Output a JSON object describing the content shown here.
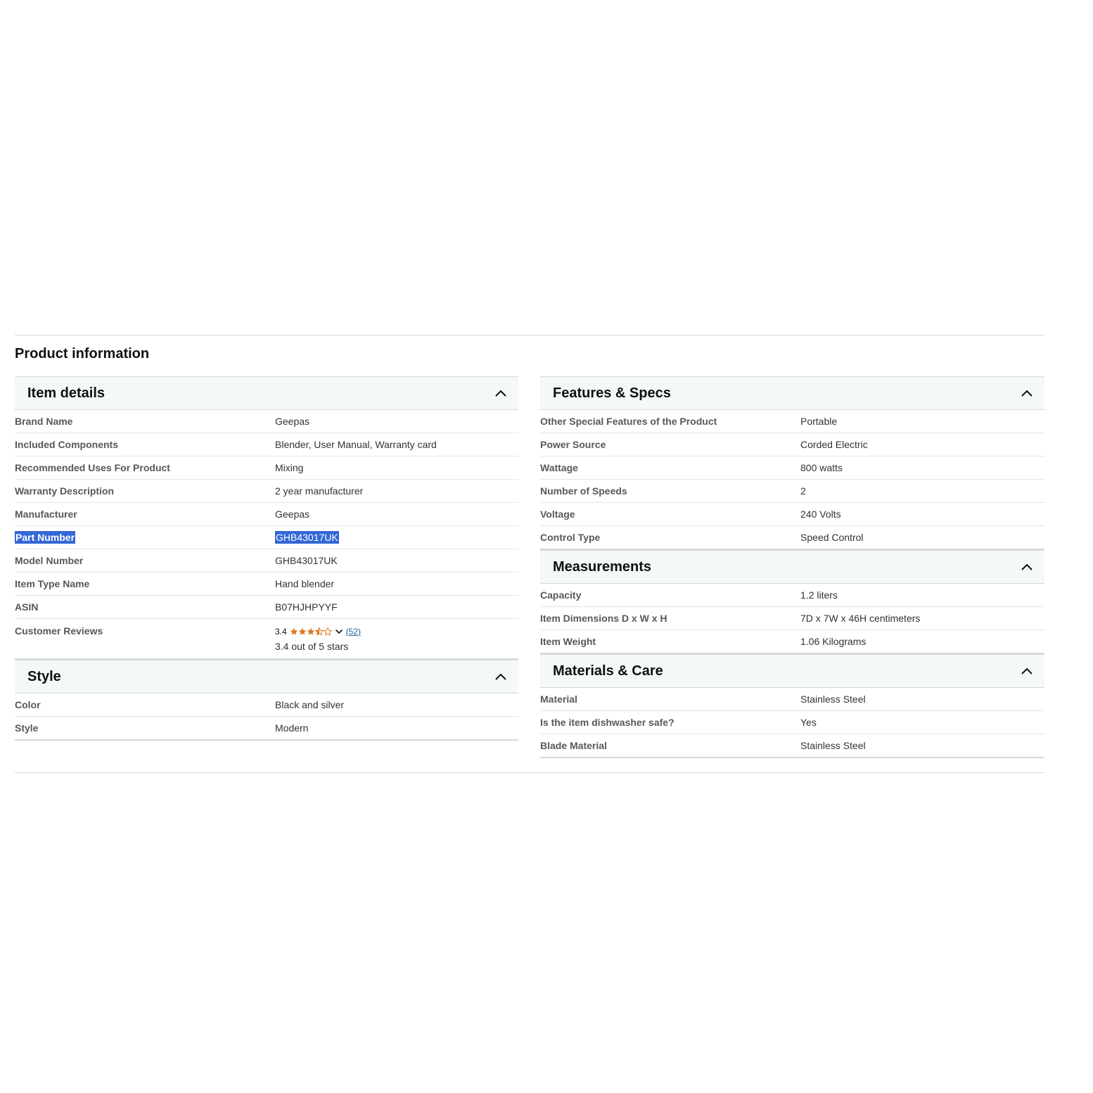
{
  "page_title": "Product information",
  "colors": {
    "accent_star": "#de7921",
    "link": "#2162a1",
    "selection": "#3367d6"
  },
  "item_details": {
    "title": "Item details",
    "rows": [
      {
        "key": "Brand Name",
        "value": "Geepas"
      },
      {
        "key": "Included Components",
        "value": "Blender, User Manual, Warranty card"
      },
      {
        "key": "Recommended Uses For Product",
        "value": "Mixing"
      },
      {
        "key": "Warranty Description",
        "value": "2 year manufacturer"
      },
      {
        "key": "Manufacturer",
        "value": "Geepas"
      },
      {
        "key": "Part Number",
        "value": "GHB43017UK"
      },
      {
        "key": "Model Number",
        "value": "GHB43017UK"
      },
      {
        "key": "Item Type Name",
        "value": "Hand blender"
      },
      {
        "key": "ASIN",
        "value": "B07HJHPYYF"
      }
    ],
    "reviews": {
      "key": "Customer Reviews",
      "rating": "3.4",
      "rating_value": 3.4,
      "max_stars": 5,
      "count_text": "(52)",
      "summary": "3.4 out of 5 stars"
    }
  },
  "style": {
    "title": "Style",
    "rows": [
      {
        "key": "Color",
        "value": "Black and silver"
      },
      {
        "key": "Style",
        "value": "Modern"
      }
    ]
  },
  "features_specs": {
    "title": "Features & Specs",
    "rows": [
      {
        "key": "Other Special Features of the Product",
        "value": "Portable"
      },
      {
        "key": "Power Source",
        "value": "Corded Electric"
      },
      {
        "key": "Wattage",
        "value": "800 watts"
      },
      {
        "key": "Number of Speeds",
        "value": "2"
      },
      {
        "key": "Voltage",
        "value": "240 Volts"
      },
      {
        "key": "Control Type",
        "value": "Speed Control"
      }
    ]
  },
  "measurements": {
    "title": "Measurements",
    "rows": [
      {
        "key": "Capacity",
        "value": "1.2 liters"
      },
      {
        "key": "Item Dimensions D x W x H",
        "value": "7D x 7W x 46H centimeters"
      },
      {
        "key": "Item Weight",
        "value": "1.06 Kilograms"
      }
    ]
  },
  "materials_care": {
    "title": "Materials & Care",
    "rows": [
      {
        "key": "Material",
        "value": "Stainless Steel"
      },
      {
        "key": "Is the item dishwasher safe?",
        "value": "Yes"
      },
      {
        "key": "Blade Material",
        "value": "Stainless Steel"
      }
    ]
  }
}
